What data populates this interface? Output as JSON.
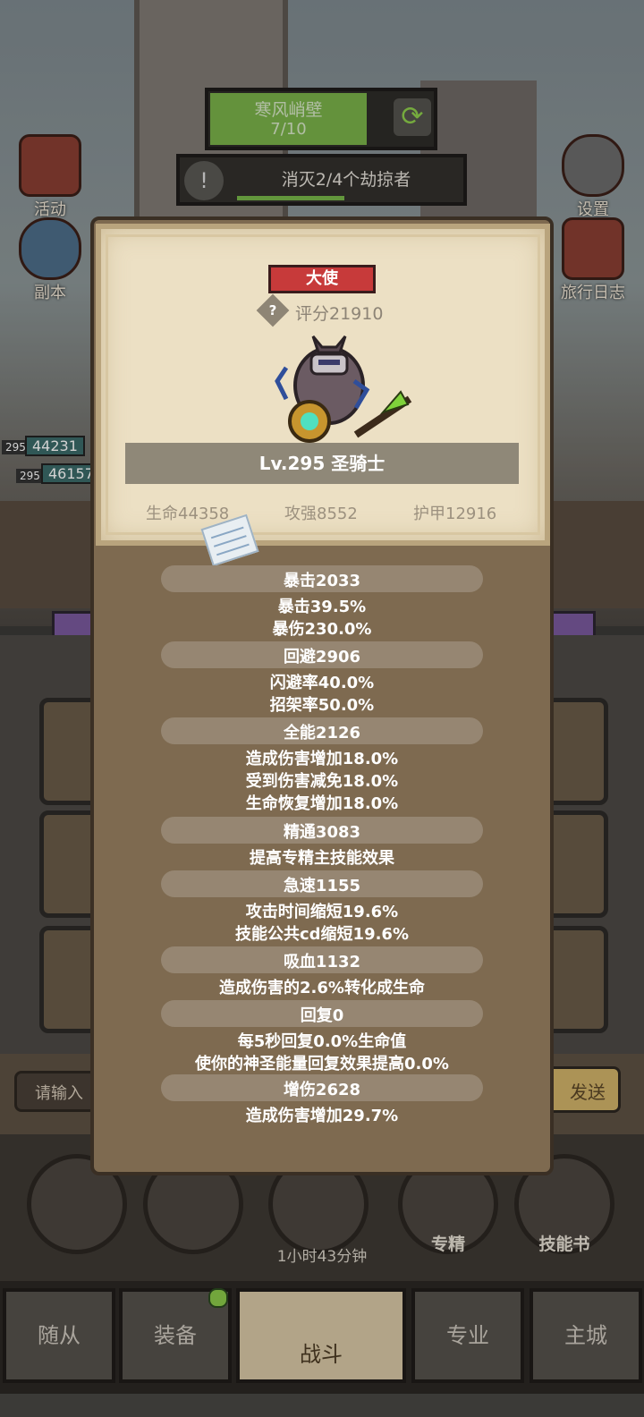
{
  "hud": {
    "stage_name": "寒风峭壁",
    "stage_progress": "7/10",
    "quest_text": "消灭2/4个劫掠者",
    "left_icons": [
      "活动",
      "副本"
    ],
    "right_icons": [
      "设置",
      "旅行日志"
    ],
    "level_chips": [
      "295",
      "295"
    ],
    "hp_chips": [
      "44231",
      "46157"
    ]
  },
  "chat": {
    "placeholder": "请输入",
    "send_label": "发送"
  },
  "bottom_buttons": [
    {
      "label": ""
    },
    {
      "label": ""
    },
    {
      "label": ""
    },
    {
      "label": "专精"
    },
    {
      "label": "技能书"
    }
  ],
  "timer_text": "1小时43分钟",
  "nav_tabs": [
    "随从",
    "装备",
    "战斗",
    "专业",
    "主城"
  ],
  "hero": {
    "title_badge": "大使",
    "score_label": "评分21910",
    "name": "Lv.295 圣骑士",
    "base_stats": [
      "生命44358",
      "攻强8552",
      "护甲12916"
    ]
  },
  "stats": [
    {
      "header": "暴击2033",
      "lines": [
        "暴击39.5%",
        "暴伤230.0%"
      ]
    },
    {
      "header": "回避2906",
      "lines": [
        "闪避率40.0%",
        "招架率50.0%"
      ]
    },
    {
      "header": "全能2126",
      "lines": [
        "造成伤害增加18.0%",
        "受到伤害减免18.0%",
        "生命恢复增加18.0%"
      ]
    },
    {
      "header": "精通3083",
      "lines": [
        "提高专精主技能效果"
      ]
    },
    {
      "header": "急速1155",
      "lines": [
        "攻击时间缩短19.6%",
        "技能公共cd缩短19.6%"
      ]
    },
    {
      "header": "吸血1132",
      "lines": [
        "造成伤害的2.6%转化成生命"
      ]
    },
    {
      "header": "回复0",
      "lines": [
        "每5秒回复0.0%生命值",
        "使你的神圣能量回复效果提高0.0%"
      ]
    },
    {
      "header": "增伤2628",
      "lines": [
        "造成伤害增加29.7%"
      ]
    }
  ],
  "colors": {
    "badge_red": "#c73a3a",
    "modal_brown": "#7e6a50",
    "card_parchment": "#ece0c4",
    "stat_pill": "#968672",
    "progress_green": "#7bb24a"
  }
}
